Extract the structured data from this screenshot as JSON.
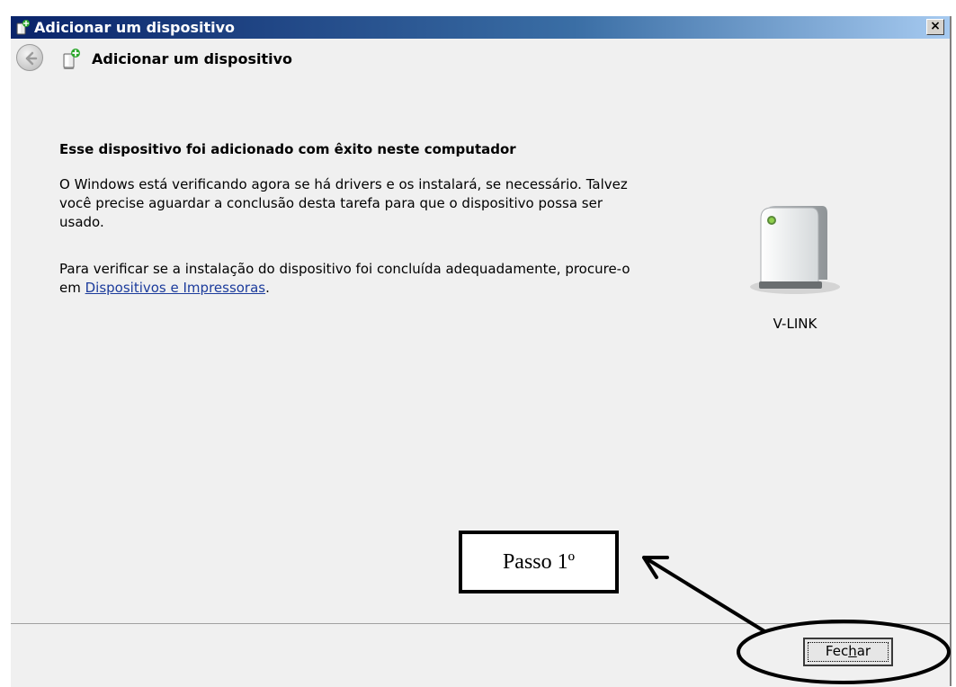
{
  "window": {
    "title": "Adicionar um dispositivo",
    "close_label": "×"
  },
  "nav": {
    "title": "Adicionar um dispositivo"
  },
  "content": {
    "heading": "Esse dispositivo foi adicionado com êxito neste computador",
    "paragraph1": "O Windows está verificando agora se há drivers e os instalará, se necessário. Talvez você precise aguardar a conclusão desta tarefa para que o dispositivo possa ser usado.",
    "paragraph2_prefix": "Para verificar se a instalação do dispositivo foi concluída adequadamente, procure-o em ",
    "paragraph2_link": "Dispositivos e Impressoras",
    "paragraph2_suffix": ".",
    "device_label": "V-LINK"
  },
  "footer": {
    "close_button_before": "Fec",
    "close_button_hotkey": "h",
    "close_button_after": "ar"
  },
  "annotation": {
    "step_label": "Passo 1º"
  },
  "icons": [
    "device-add-icon",
    "back-arrow-icon",
    "external-storage-device-icon",
    "close-icon"
  ]
}
